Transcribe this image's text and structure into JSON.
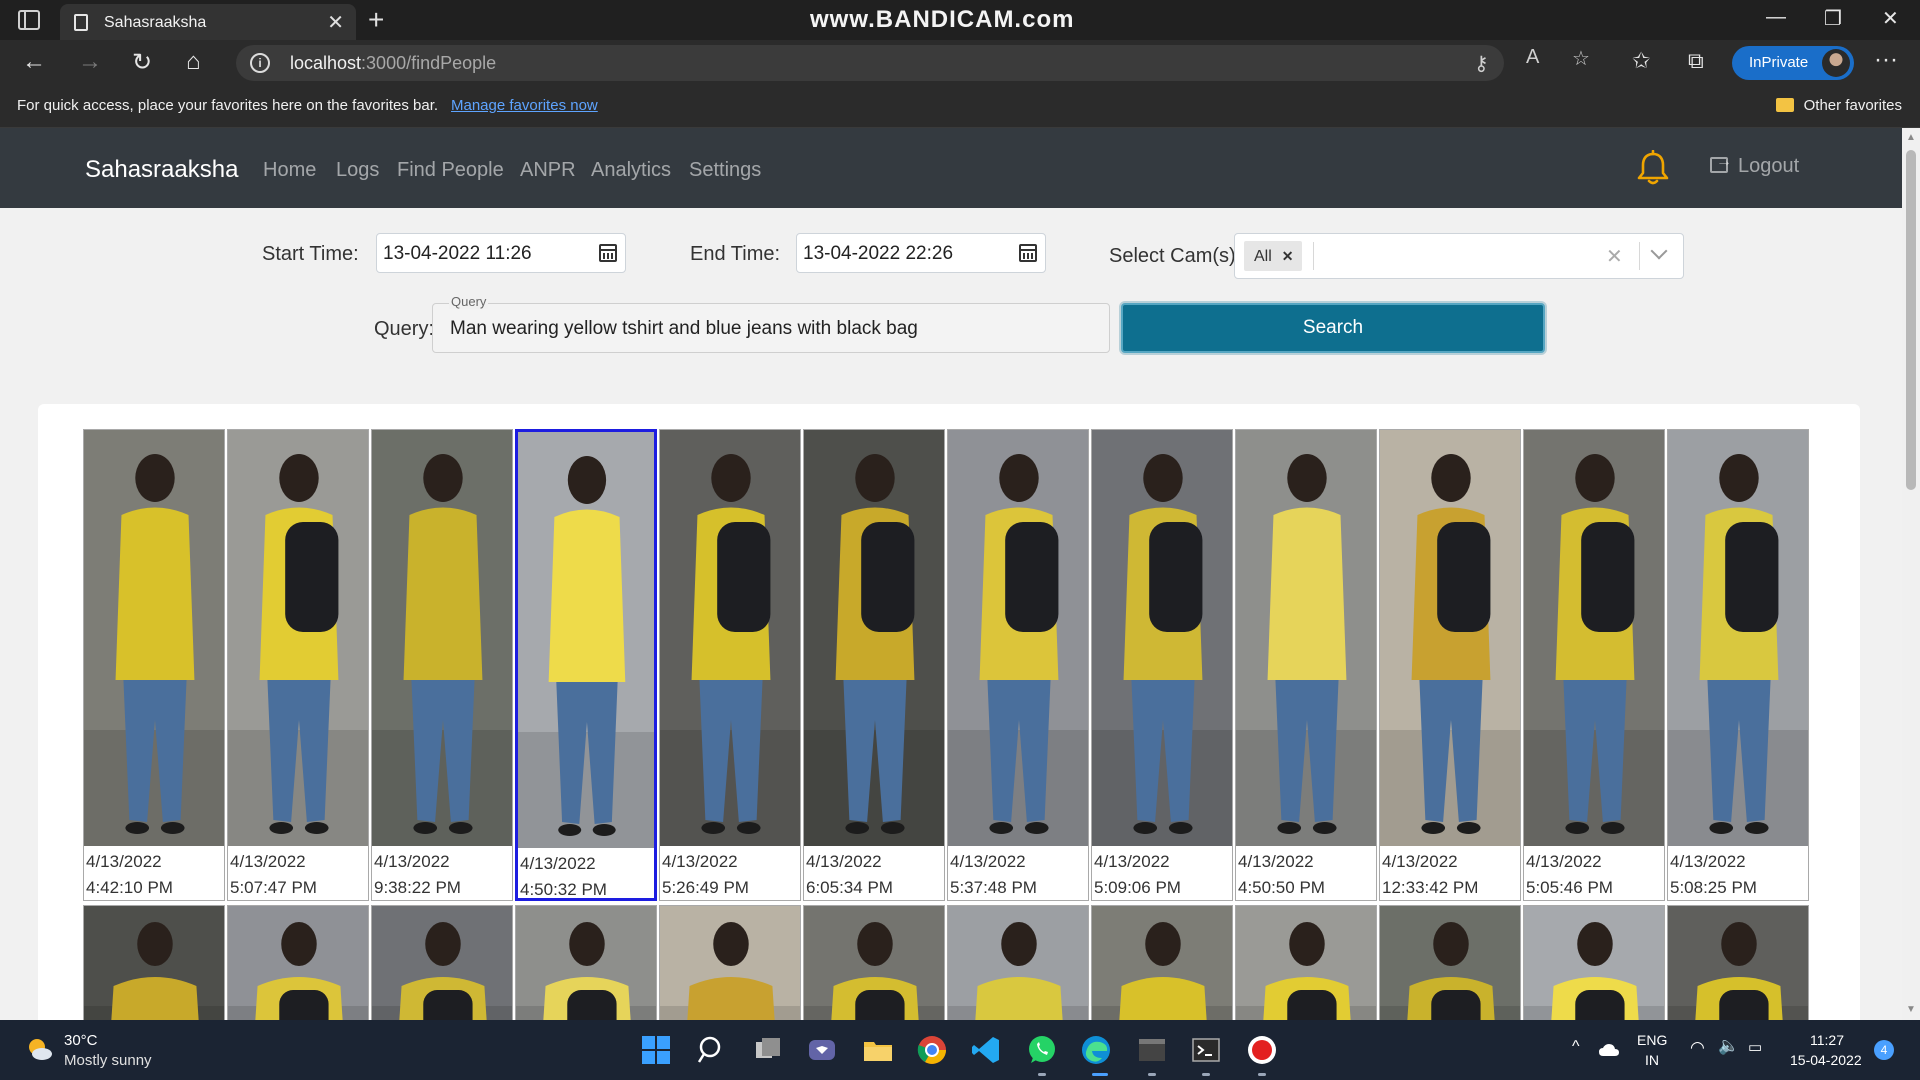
{
  "browser": {
    "tab_title": "Sahasraaksha",
    "watermark": "www.BANDICAM.com",
    "url_host": "localhost",
    "url_path": ":3000/findPeople",
    "inprivate_label": "InPrivate",
    "favorites_prompt": "For quick access, place your favorites here on the favorites bar.",
    "favorites_link": "Manage favorites now",
    "other_favorites": "Other favorites"
  },
  "app": {
    "brand": "Sahasraaksha",
    "nav": [
      "Home",
      "Logs",
      "Find People",
      "ANPR",
      "Analytics",
      "Settings"
    ],
    "logout": "Logout"
  },
  "filters": {
    "start_label": "Start Time:",
    "start_value": "13-04-2022 11:26",
    "end_label": "End Time:",
    "end_value": "13-04-2022 22:26",
    "cam_label": "Select Cam(s):",
    "cam_selected": "All",
    "query_label": "Query:",
    "query_legend": "Query",
    "query_value": "Man wearing yellow tshirt and blue jeans with black bag",
    "search_button": "Search"
  },
  "results": {
    "row1": [
      {
        "date": "4/13/2022",
        "time": "4:42:10 PM"
      },
      {
        "date": "4/13/2022",
        "time": "5:07:47 PM"
      },
      {
        "date": "4/13/2022",
        "time": "9:38:22 PM"
      },
      {
        "date": "4/13/2022",
        "time": "4:50:32 PM"
      },
      {
        "date": "4/13/2022",
        "time": "5:26:49 PM"
      },
      {
        "date": "4/13/2022",
        "time": "6:05:34 PM"
      },
      {
        "date": "4/13/2022",
        "time": "5:37:48 PM"
      },
      {
        "date": "4/13/2022",
        "time": "5:09:06 PM"
      },
      {
        "date": "4/13/2022",
        "time": "4:50:50 PM"
      },
      {
        "date": "4/13/2022",
        "time": "12:33:42 PM"
      },
      {
        "date": "4/13/2022",
        "time": "5:05:46 PM"
      },
      {
        "date": "4/13/2022",
        "time": "5:08:25 PM"
      }
    ],
    "selected_index": 3,
    "row2_count": 12
  },
  "taskbar": {
    "temperature": "30°C",
    "weather": "Mostly sunny",
    "lang": "ENG",
    "region": "IN",
    "time": "11:27",
    "date": "15-04-2022",
    "notifications": "4"
  },
  "colors": {
    "navbar": "#343a40",
    "search_button": "#0e6f8f",
    "selected_border": "#1d1de0",
    "bell": "#f0a500"
  }
}
